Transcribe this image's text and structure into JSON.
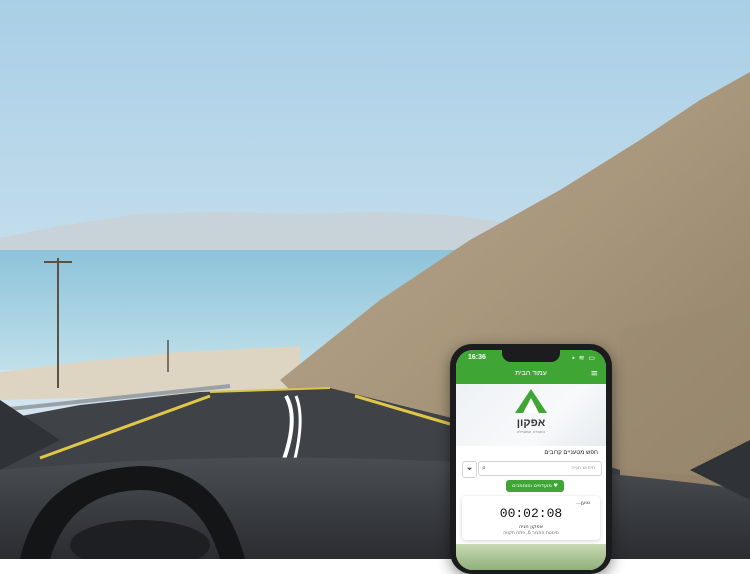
{
  "status_bar": {
    "time": "16:36",
    "icons": "▪ ≋ ▭"
  },
  "nav": {
    "title": "עמוד הבית",
    "menu_icon": "menu-icon"
  },
  "logo": {
    "word": "אפקון",
    "subtitle": "החברה המובילה"
  },
  "nearby": {
    "title": "חפש מטעניים קרובים",
    "search_placeholder": "חיפוש חניה",
    "favorites_label": "מועדפים ומוסמכים"
  },
  "session": {
    "status": "טוען...",
    "timer": "00:02:08",
    "lot_name": "אפקון חניה",
    "address": "סימטת התבור 6, פתח תקווה"
  },
  "colors": {
    "brand_green": "#3fa535"
  }
}
